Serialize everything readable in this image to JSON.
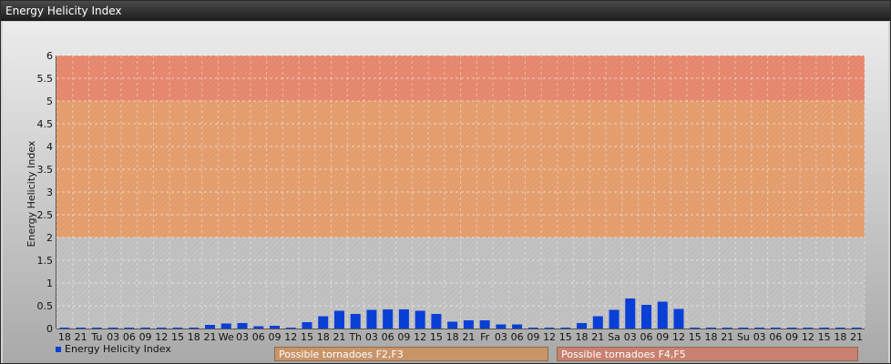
{
  "window": {
    "title": "Energy Helicity Index"
  },
  "chart_data": {
    "type": "bar",
    "ylabel": "Energy Helicity Index",
    "ylim": [
      0,
      6
    ],
    "yticks": [
      "0",
      "0.5",
      "1",
      "1.5",
      "2",
      "2.5",
      "3",
      "3.5",
      "4",
      "4.5",
      "5",
      "5.5",
      "6"
    ],
    "categories": [
      "18",
      "21",
      "Tu",
      "03",
      "06",
      "09",
      "12",
      "15",
      "18",
      "21",
      "We",
      "03",
      "06",
      "09",
      "12",
      "15",
      "18",
      "21",
      "Th",
      "03",
      "06",
      "09",
      "12",
      "15",
      "18",
      "21",
      "Fr",
      "03",
      "06",
      "09",
      "12",
      "15",
      "18",
      "21",
      "Sa",
      "03",
      "06",
      "09",
      "12",
      "15",
      "18",
      "21",
      "Su",
      "03",
      "06",
      "09",
      "12",
      "15",
      "18",
      "21"
    ],
    "series": [
      {
        "name": "Energy Helicity Index",
        "color": "#0a3fd6",
        "values": [
          0.02,
          0.02,
          0.02,
          0.02,
          0.02,
          0.02,
          0.02,
          0.02,
          0.02,
          0.08,
          0.11,
          0.12,
          0.05,
          0.06,
          0.02,
          0.14,
          0.27,
          0.39,
          0.32,
          0.41,
          0.42,
          0.42,
          0.39,
          0.32,
          0.15,
          0.18,
          0.18,
          0.09,
          0.09,
          0.02,
          0.02,
          0.02,
          0.12,
          0.27,
          0.41,
          0.66,
          0.52,
          0.59,
          0.43,
          0.02,
          0.02,
          0.02,
          0.02,
          0.02,
          0.02,
          0.02,
          0.02,
          0.02,
          0.02,
          0.02
        ]
      }
    ],
    "bands": [
      {
        "from": 0,
        "to": 2,
        "color": "#c2c2c2"
      },
      {
        "from": 2,
        "to": 5,
        "color": "#e6a070"
      },
      {
        "from": 5,
        "to": 6,
        "color": "#e88a70"
      }
    ],
    "grid": true,
    "legend_position": "bottom-left",
    "annotations": [
      {
        "label": "Possible tornadoes F2,F3",
        "color": "#c99468"
      },
      {
        "label": "Possible tornadoes F4,F5",
        "color": "#c98070"
      }
    ]
  }
}
